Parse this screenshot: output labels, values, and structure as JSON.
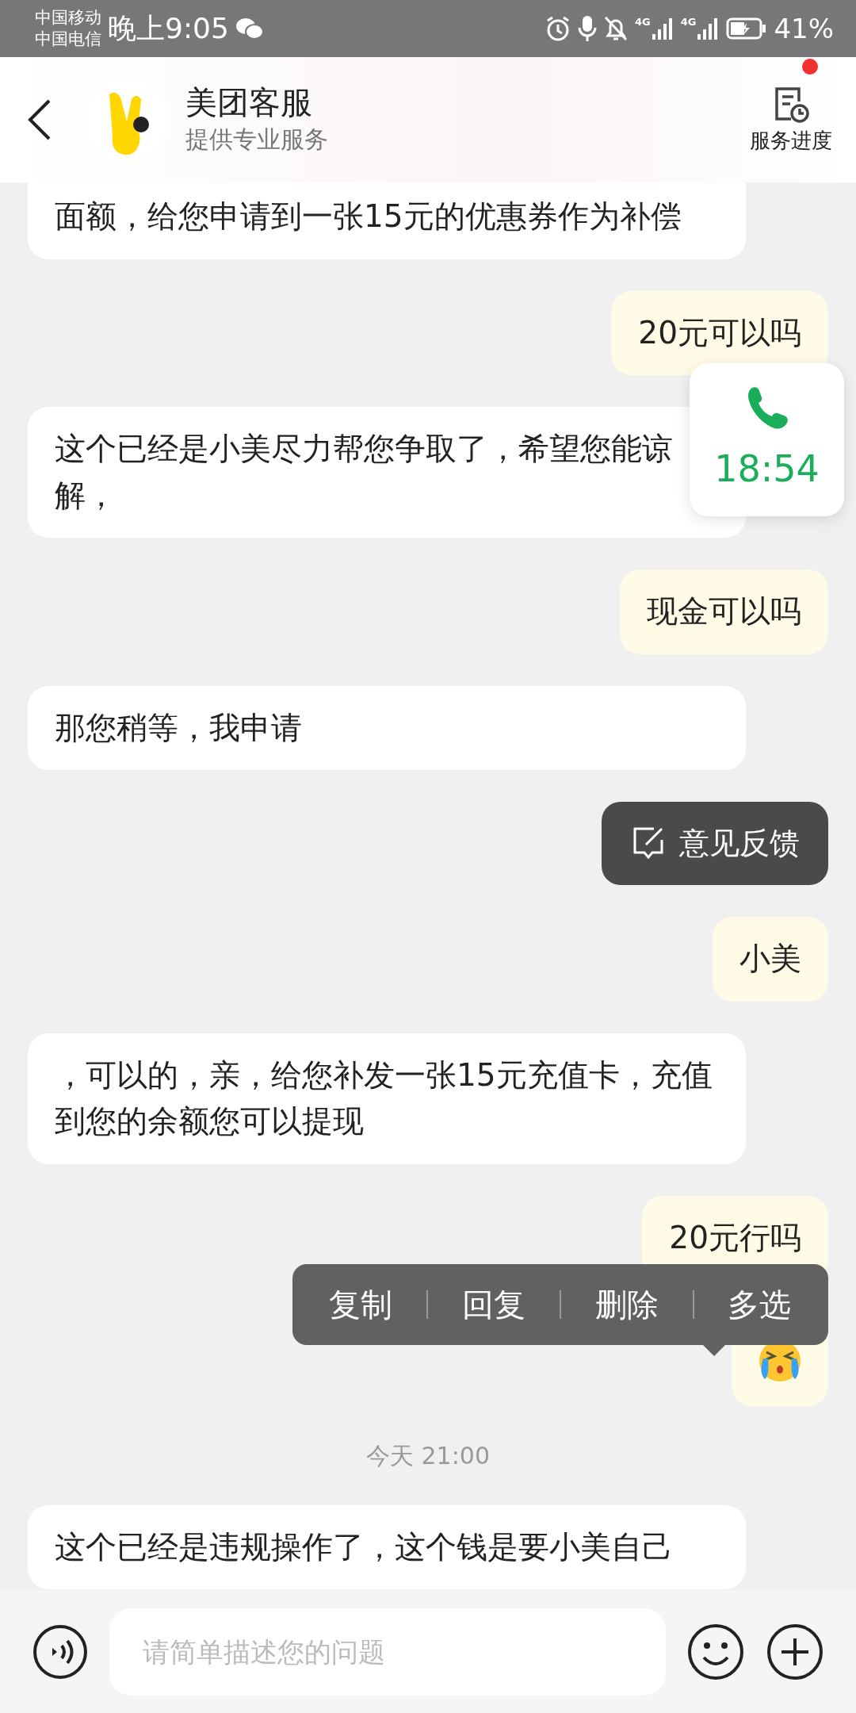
{
  "status_bar": {
    "carriers": [
      "中国移动",
      "中国电信"
    ],
    "time": "晚上9:05",
    "network": [
      "4G",
      "4G"
    ],
    "battery": "41%"
  },
  "header": {
    "title": "美团客服",
    "subtitle": "提供专业服务",
    "action": "服务进度",
    "action_badge": true
  },
  "messages": [
    {
      "kind": "text",
      "outgoing": false,
      "text": "面额，给您申请到一张15元的优惠券作为补偿"
    },
    {
      "kind": "text",
      "outgoing": true,
      "text": "20元可以吗"
    },
    {
      "kind": "text",
      "outgoing": false,
      "text": "这个已经是小美尽力帮您争取了，希望您能谅解，"
    },
    {
      "kind": "text",
      "outgoing": true,
      "text": "现金可以吗"
    },
    {
      "kind": "text",
      "outgoing": false,
      "text": "那您稍等，我申请"
    },
    {
      "kind": "feedback",
      "text": "意见反馈"
    },
    {
      "kind": "text",
      "outgoing": true,
      "text": "小美"
    },
    {
      "kind": "text",
      "outgoing": false,
      "text": "，可以的，亲，给您补发一张15元充值卡，充值到您的余额您可以提现"
    },
    {
      "kind": "text",
      "outgoing": true,
      "text": "20元行吗"
    },
    {
      "kind": "emoji",
      "outgoing": true,
      "menu_open": true
    },
    {
      "kind": "time",
      "text": "今天 21:00"
    },
    {
      "kind": "text",
      "outgoing": false,
      "text": "这个已经是违规操作了，这个钱是要小美自己"
    }
  ],
  "context_menu": {
    "items": [
      "复制",
      "回复",
      "删除",
      "多选"
    ]
  },
  "call_widget": {
    "duration": "18:54"
  },
  "input": {
    "placeholder": "请简单描述您的问题"
  }
}
